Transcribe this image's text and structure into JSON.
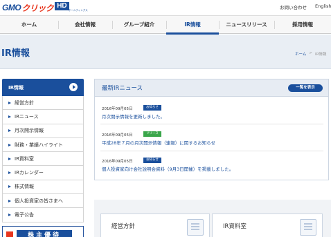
{
  "header": {
    "logo": {
      "gmo": "GMO",
      "click": "クリック",
      "hd": "HD",
      "sub": "ホールディングス"
    },
    "links": {
      "contact": "お問い合わせ",
      "english": "English"
    }
  },
  "nav": {
    "items": [
      "ホーム",
      "会社情報",
      "グループ紹介",
      "IR情報",
      "ニュースリリース",
      "採用情報"
    ],
    "active_index": 3
  },
  "page": {
    "title": "IR情報",
    "breadcrumb": {
      "home": "ホーム",
      "sep": ">",
      "current": "IR情報"
    }
  },
  "sidebar": {
    "header": "IR情報",
    "items": [
      "経営方針",
      "IRニュース",
      "月次開示情報",
      "財務・業績ハイライト",
      "IR資料室",
      "IRカレンダー",
      "株式情報",
      "個人投資家の皆さまへ",
      "電子公告"
    ],
    "banner": "株主優待"
  },
  "news": {
    "title": "最新IRニュース",
    "all_button": "一覧を表示",
    "rows": [
      {
        "date": "2016年09月05日",
        "badge": "お知らせ",
        "badge_color": "#1a4f9c",
        "text": "月次開示情報を更新しました。"
      },
      {
        "date": "2016年09月05日",
        "badge": "リリース",
        "badge_color": "#3aa64a",
        "text": "平成28年７月の月次開示情報（速報）に関するお知らせ"
      },
      {
        "date": "2016年09月05日",
        "badge": "お知らせ",
        "badge_color": "#1a4f9c",
        "text": "個人投資家向け会社説明会資料（9月3日開催）を掲載しました。"
      }
    ]
  },
  "cards": [
    {
      "title": "経営方針",
      "icon": "document-icon"
    },
    {
      "title": "IR資料室",
      "icon": "document-icon"
    }
  ]
}
